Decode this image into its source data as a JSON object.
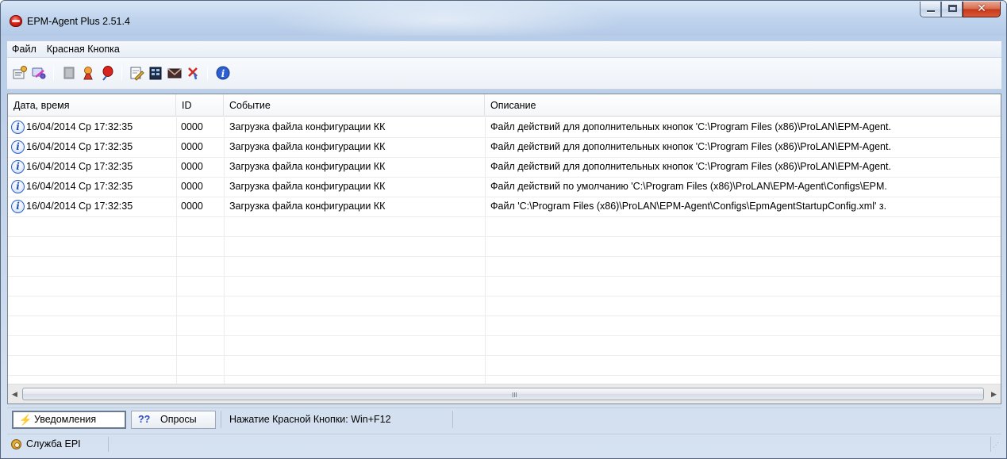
{
  "window": {
    "title": "EPM-Agent Plus 2.51.4"
  },
  "menu": {
    "items": [
      {
        "label": "Файл"
      },
      {
        "label": "Красная Кнопка"
      }
    ]
  },
  "toolbar": {
    "buttons": [
      {
        "icon": "settings-card-icon"
      },
      {
        "icon": "refresh-connect-icon"
      },
      {
        "icon": "disabled-book-icon"
      },
      {
        "icon": "user-award-icon"
      },
      {
        "icon": "red-balloon-icon"
      },
      {
        "icon": "edit-document-icon"
      },
      {
        "icon": "film-table-icon"
      },
      {
        "icon": "mail-envelope-icon"
      },
      {
        "icon": "delete-pin-icon"
      },
      {
        "icon": "info-icon"
      }
    ]
  },
  "listview": {
    "columns": [
      {
        "label": "Дата, время"
      },
      {
        "label": "ID"
      },
      {
        "label": "Событие"
      },
      {
        "label": "Описание"
      }
    ],
    "rows": [
      {
        "datetime": "16/04/2014 Ср 17:32:35",
        "id": "0000",
        "event": "Загрузка файла конфигурации КК",
        "description": "Файл действий для дополнительных кнопок 'C:\\Program Files (x86)\\ProLAN\\EPM-Agent."
      },
      {
        "datetime": "16/04/2014 Ср 17:32:35",
        "id": "0000",
        "event": "Загрузка файла конфигурации КК",
        "description": "Файл действий для дополнительных кнопок 'C:\\Program Files (x86)\\ProLAN\\EPM-Agent."
      },
      {
        "datetime": "16/04/2014 Ср 17:32:35",
        "id": "0000",
        "event": "Загрузка файла конфигурации КК",
        "description": "Файл действий для дополнительных кнопок 'C:\\Program Files (x86)\\ProLAN\\EPM-Agent."
      },
      {
        "datetime": "16/04/2014 Ср 17:32:35",
        "id": "0000",
        "event": "Загрузка файла конфигурации КК",
        "description": "Файл действий по умолчанию 'C:\\Program Files (x86)\\ProLAN\\EPM-Agent\\Configs\\EPM."
      },
      {
        "datetime": "16/04/2014 Ср 17:32:35",
        "id": "0000",
        "event": "Загрузка файла конфигурации КК",
        "description": "Файл 'C:\\Program Files (x86)\\ProLAN\\EPM-Agent\\Configs\\EpmAgentStartupConfig.xml' з."
      }
    ],
    "scroll_grip": "III"
  },
  "tabs": {
    "notifications": {
      "label": "Уведомления",
      "glyph": "⚡"
    },
    "polls": {
      "label": "Опросы",
      "glyph": "??"
    },
    "hotkey_text": "Нажатие Красной Кнопки: Win+F12"
  },
  "status": {
    "service_text": "Служба EPI"
  },
  "colors": {
    "accent": "#2d62c4",
    "title_bg": "#c0d4ed",
    "close_button": "#c5381a"
  }
}
